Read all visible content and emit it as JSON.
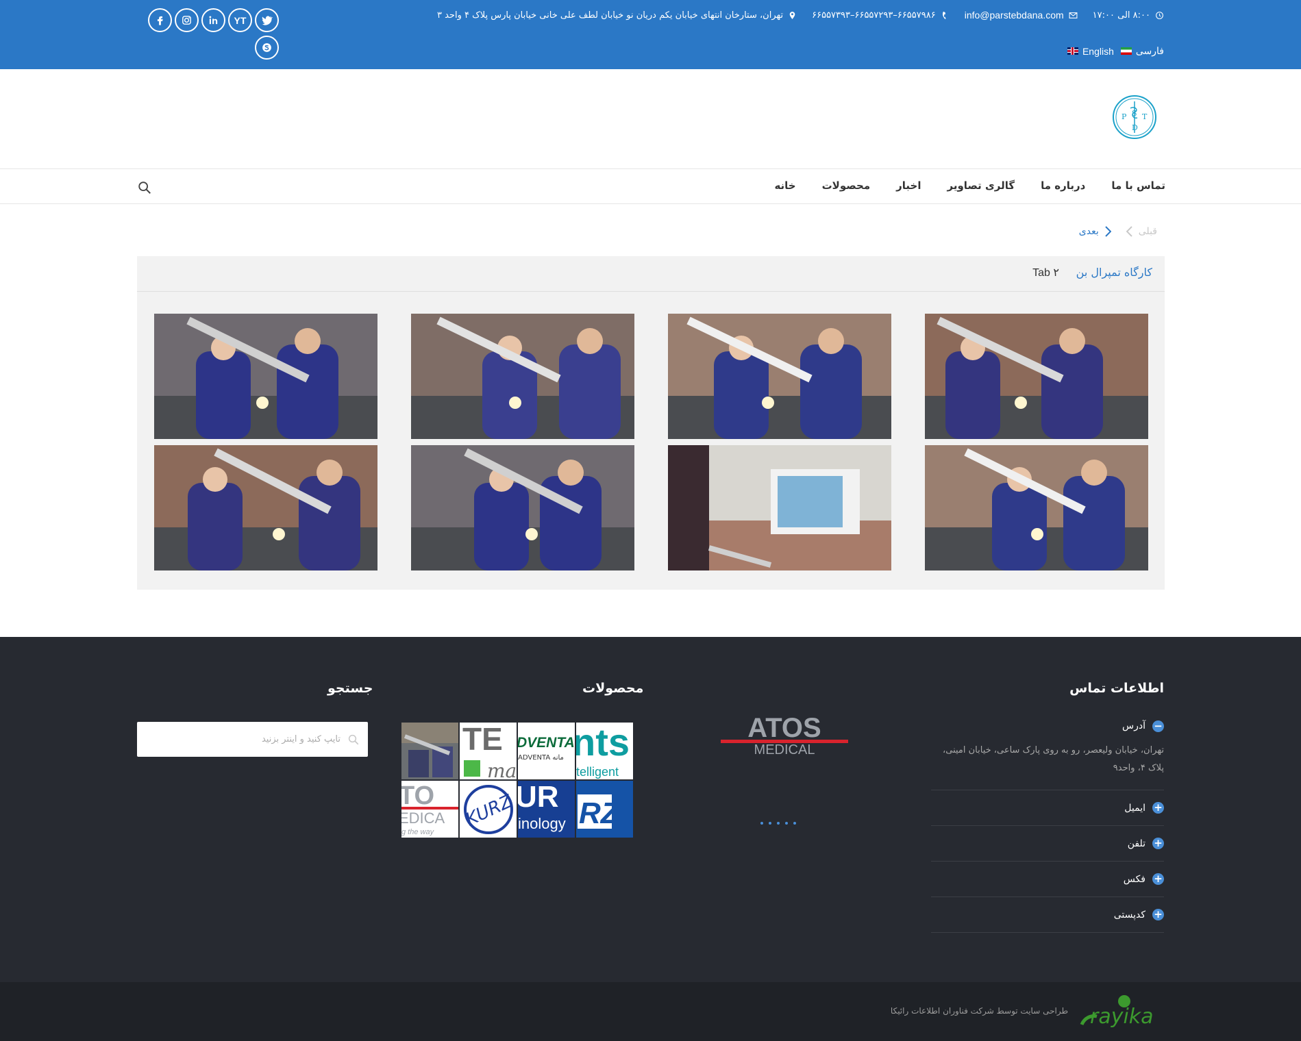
{
  "topbar": {
    "address": "تهران، ستارخان انتهای خیابان یکم دریان نو خیابان لطف علی خانی خیابان پارس پلاک ۴ واحد ۳",
    "phone": "۶۶۵۵۷۹۸۶–۶۶۵۵۷۲۹۳–۶۶۵۵۷۳۹۳",
    "email": "info@parstebdana.com",
    "hours": "۸:۰۰ الی ۱۷:۰۰",
    "languages": [
      "فارسی",
      "English"
    ],
    "social": [
      "twitter-icon",
      "youtube-icon",
      "linkedin-icon",
      "instagram-icon",
      "facebook-icon",
      "skype-icon"
    ],
    "youtube_text": "YT",
    "bg_color": "#2b78c6"
  },
  "logo": {
    "letters": [
      "P",
      "T",
      "S",
      "D"
    ]
  },
  "nav": {
    "items": [
      "خانه",
      "محصولات",
      "اخبار",
      "گالری تصاویر",
      "درباره ما",
      "تماس با ما"
    ]
  },
  "pager": {
    "next": "بعدی",
    "prev": "قبلی"
  },
  "gallery": {
    "tabs": [
      "کارگاه تمپرال بن",
      "Tab ۲"
    ],
    "active_tab": 0,
    "photo_count": 8
  },
  "footer": {
    "contact_title": "اطلاعات تماس",
    "contact_items": [
      {
        "label": "آدرس",
        "expanded": true
      },
      {
        "label": "ایمیل",
        "expanded": false
      },
      {
        "label": "تلفن",
        "expanded": false
      },
      {
        "label": "فکس",
        "expanded": false
      },
      {
        "label": "کدپستی",
        "expanded": false
      }
    ],
    "address_text": "تهران، خیابان ولیعصر، رو به روی پارک ساعی، خیابان امینی، پلاک ۴، واحد۹",
    "atos_logo": {
      "line1": "ATOS",
      "line2": "MEDICAL"
    },
    "products_title": "محصولات",
    "brand_fragments": [
      "TE",
      "DVENTA",
      "nts",
      "TO",
      "KURZ",
      "UR",
      "RZ"
    ],
    "brand_subtexts": [
      "ma",
      "ADVENTA ما‌نه",
      "telligent",
      "EDICA",
      "g the way",
      "inology"
    ],
    "search_title": "جستجو",
    "search_placeholder": "تایپ کنید و اینتر بزنید",
    "accent": "#4a8fd8"
  },
  "bottom": {
    "credit": "طراحی سایت توسط شرکت فناوران اطلاعات رائیکا",
    "logo_text": "rayika",
    "logo_color": "#3c9a2e"
  }
}
